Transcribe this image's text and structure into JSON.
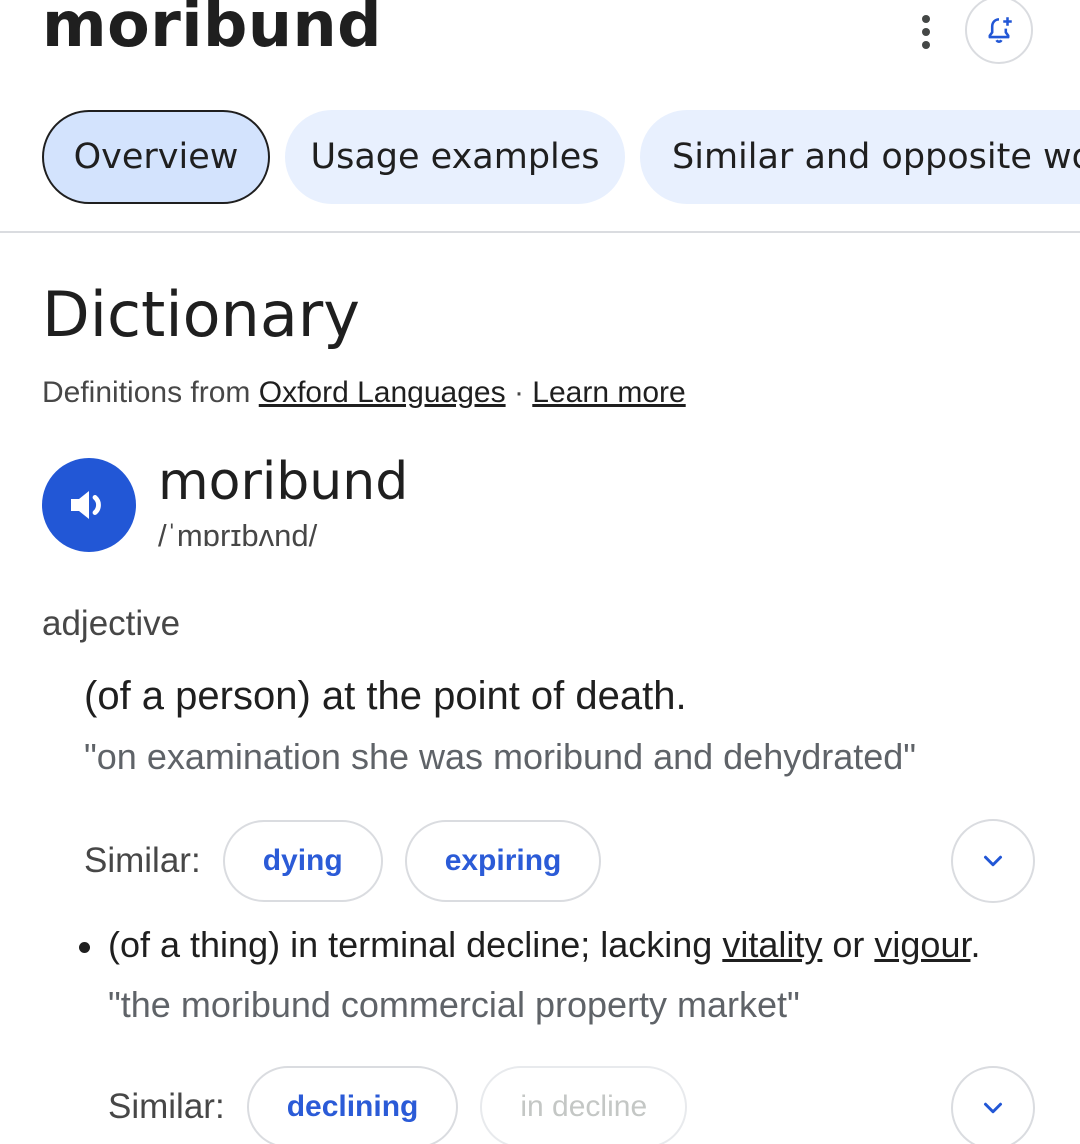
{
  "header": {
    "title": "moribund",
    "more_icon": "more-vert-icon",
    "bell_icon": "bell-plus-icon"
  },
  "tabs": [
    {
      "label": "Overview",
      "active": true
    },
    {
      "label": "Usage examples",
      "active": false
    },
    {
      "label": "Similar and opposite wo",
      "active": false
    }
  ],
  "section": {
    "title": "Dictionary",
    "source_prefix": "Definitions from",
    "source_link": "Oxford Languages",
    "separator": "·",
    "learn_more": "Learn more"
  },
  "entry": {
    "word": "moribund",
    "phonetic": "/ˈmɒrɪbʌnd/",
    "speaker_icon": "speaker-icon",
    "part_of_speech": "adjective",
    "senses": [
      {
        "definition": "(of a person) at the point of death.",
        "example": "\"on examination she was moribund and dehydrated\"",
        "similar_label": "Similar:",
        "similar": [
          "dying",
          "expiring"
        ]
      },
      {
        "definition_start": "(of a thing) in terminal decline; lacking",
        "link1": "vitality",
        "connector": "or",
        "link2": "vigour",
        "definition_end": ".",
        "example": "\"the moribund commercial property market\"",
        "similar_label": "Similar:",
        "similar": [
          "declining",
          "in decline"
        ]
      }
    ]
  },
  "colors": {
    "accent": "#2257d6",
    "chip_text": "#2b5bd7",
    "tab_active_bg": "#d3e3fd",
    "tab_bg": "#e8f0fe"
  }
}
